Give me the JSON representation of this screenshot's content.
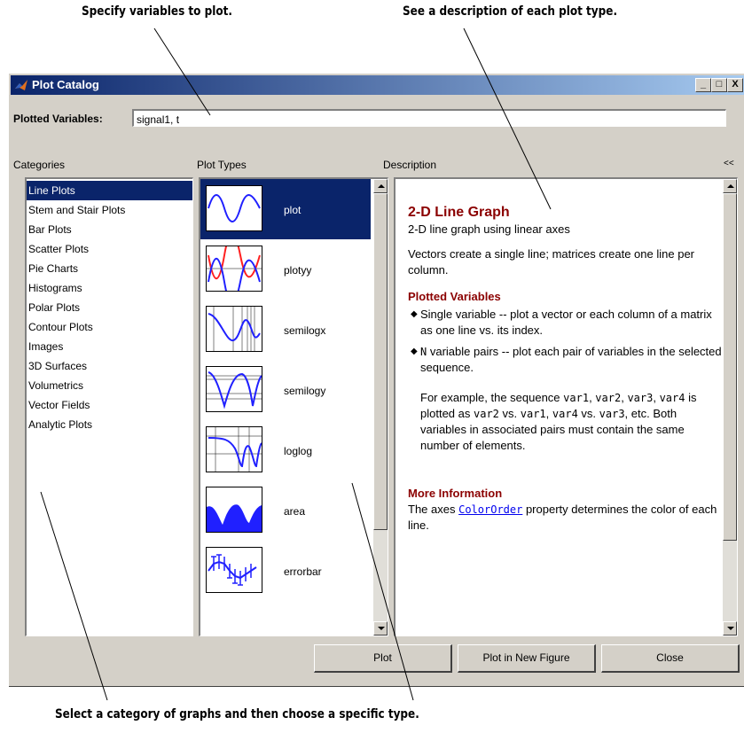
{
  "callouts": {
    "top_left": "Specify variables to plot.",
    "top_right": "See a description of each plot type.",
    "bottom": "Select a category of graphs and then choose a specific type."
  },
  "window": {
    "title": "Plot Catalog",
    "buttons": {
      "minimize": "_",
      "maximize": "□",
      "close": "X"
    }
  },
  "plotted_variables": {
    "label": "Plotted Variables:",
    "value": "signal1, t"
  },
  "categories": {
    "header": "Categories",
    "items": [
      "Line Plots",
      "Stem and Stair Plots",
      "Bar Plots",
      "Scatter Plots",
      "Pie Charts",
      "Histograms",
      "Polar Plots",
      "Contour Plots",
      "Images",
      "3D Surfaces",
      "Volumetrics",
      "Vector Fields",
      "Analytic Plots"
    ],
    "selected": "Line Plots"
  },
  "plot_types": {
    "header": "Plot Types",
    "items": [
      "plot",
      "plotyy",
      "semilogx",
      "semilogy",
      "loglog",
      "area",
      "errorbar"
    ],
    "selected": "plot"
  },
  "description": {
    "header": "Description",
    "collapse": "<<",
    "title": "2-D Line Graph",
    "subtitle": "2-D line graph using linear axes",
    "intro": "Vectors create a single line; matrices create one line per column.",
    "plotted_variables_heading": "Plotted Variables",
    "bullet1": "Single variable -- plot a vector or each column of a matrix as one line vs. its index.",
    "bullet2_code": "N",
    "bullet2_text": " variable pairs -- plot each pair of variables in the selected sequence.",
    "example_p1": "For example, the sequence ",
    "example_c1": "var1",
    "example_p2": ", ",
    "example_c2": "var2",
    "example_p3": ", ",
    "example_c3": "var3",
    "example_p4": ", ",
    "example_c4": "var4",
    "example_p5": " is plotted as ",
    "example_c5": "var2",
    "example_p6": " vs. ",
    "example_c6": "var1",
    "example_p7": ", ",
    "example_c7": "var4",
    "example_p8": " vs. ",
    "example_c8": "var3",
    "example_p9": ", etc. Both variables in associated pairs must contain the same number of elements.",
    "more_info_heading": "More Information",
    "more_info_p1": "The axes ",
    "more_info_link": "ColorOrder",
    "more_info_p2": " property determines the color of each line."
  },
  "buttons": {
    "plot": "Plot",
    "plot_new": "Plot in New Figure",
    "close": "Close"
  },
  "colors": {
    "title_bar": "#0a246a",
    "selection": "#0a246a",
    "heading": "#8b0000",
    "link": "#0000ee",
    "plot_blue": "#2020ff",
    "plot_red": "#ff2020"
  }
}
